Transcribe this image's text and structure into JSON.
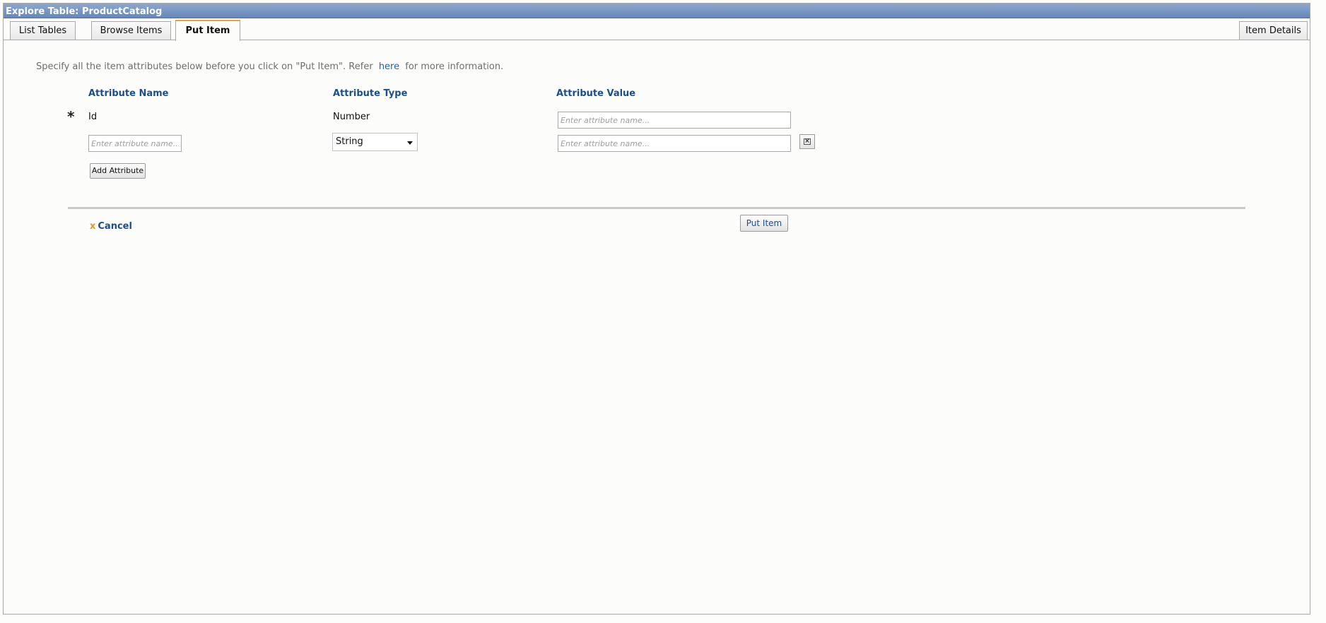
{
  "window": {
    "title": "Explore Table: ProductCatalog"
  },
  "tabs": [
    {
      "label": "List Tables"
    },
    {
      "label": "Browse Items"
    },
    {
      "label": "Put Item",
      "active": true
    },
    {
      "label": "Item Details"
    }
  ],
  "instructions": {
    "before": "Specify all the item attributes below before you click on \"Put Item\". Refer",
    "link": "here",
    "after": "for more information."
  },
  "columns": {
    "name": "Attribute Name",
    "type": "Attribute Type",
    "value": "Attribute Value"
  },
  "rows": [
    {
      "required_marker": "*",
      "name": "Id",
      "type": "Number",
      "value": "",
      "value_placeholder": "Enter attribute name..."
    },
    {
      "name": "",
      "name_placeholder": "Enter attribute name...",
      "type_selected": "String",
      "value": "",
      "value_placeholder": "Enter attribute name..."
    }
  ],
  "buttons": {
    "add_attribute": "Add Attribute",
    "put_item": "Put Item",
    "cancel": "Cancel",
    "cancel_icon": "x"
  },
  "icons": {
    "remove": "close-icon",
    "dropdown": "caret-down-icon",
    "cancel": "x-icon"
  },
  "colors": {
    "titlebar": "#6f8fc2",
    "header_text": "#1a4f8f",
    "link": "#1d63b8",
    "active_tab_accent": "#e8a33c",
    "cancel_icon": "#e8941c"
  }
}
